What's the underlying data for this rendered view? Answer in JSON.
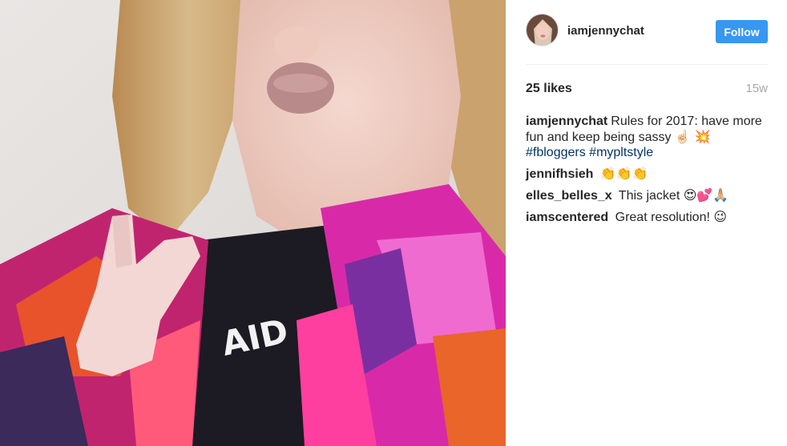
{
  "post": {
    "username": "iamjennychat",
    "follow_label": "Follow",
    "likes_text": "25 likes",
    "timestamp": "15w"
  },
  "caption": {
    "user": "iamjennychat",
    "text": "Rules for 2017: have more fun and keep being sassy",
    "emojis": "☝🏻 💥",
    "hashtags": [
      "#fbloggers",
      "#mypltstyle"
    ]
  },
  "comments": [
    {
      "user": "jennifhsieh",
      "text": "",
      "emojis": "👏👏👏"
    },
    {
      "user": "elles_belles_x",
      "text": "This jacket",
      "emojis": "😍💕🙏🏼"
    },
    {
      "user": "iamscentered",
      "text": "Great resolution!",
      "emojis": "😉"
    }
  ],
  "colors": {
    "follow_button": "#3897f0",
    "hashtag": "#003569",
    "timestamp": "#a5a7aa"
  }
}
